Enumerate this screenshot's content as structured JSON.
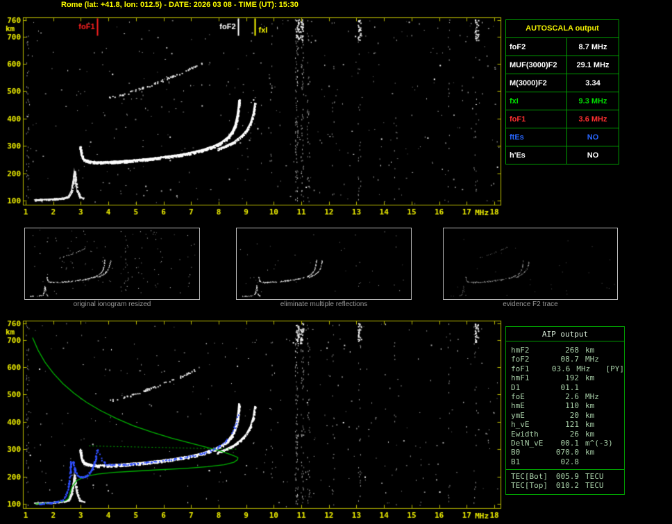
{
  "title": "Rome (lat: +41.8, lon: 012.5) - DATE: 2026 03 08 - TIME (UT): 15:30",
  "colors": {
    "background": "#000000",
    "title_yellow": "#ffff00",
    "axis_yellow": "#f0f000",
    "plot_border": "#b8b800",
    "table_border_green": "#00a000",
    "trace_white": "#ffffff",
    "profile_green": "#00b400",
    "restored_trace_blue": "#3050ff",
    "caption_gray": "#989898",
    "aip_text_green": "#a8cfa8"
  },
  "autoscala_table": {
    "header": "AUTOSCALA output",
    "rows": [
      {
        "label": "foF2",
        "value": "8.7 MHz",
        "color": "#ffffff"
      },
      {
        "label": "MUF(3000)F2",
        "value": "29.1 MHz",
        "color": "#ffffff"
      },
      {
        "label": "M(3000)F2",
        "value": "3.34",
        "color": "#ffffff"
      },
      {
        "label": "fxI",
        "value": "9.3 MHz",
        "color": "#00dd00"
      },
      {
        "label": "foF1",
        "value": "3.6 MHz",
        "color": "#ff3030"
      },
      {
        "label": "ftEs",
        "value": "NO",
        "color": "#2866ff"
      },
      {
        "label": "h'Es",
        "value": "NO",
        "color": "#ffffff"
      }
    ]
  },
  "thumbnails": [
    {
      "caption": "original ionogram resized"
    },
    {
      "caption": "eliminate multiple reflections"
    },
    {
      "caption": "evidence F2 trace"
    }
  ],
  "aip_table": {
    "header": "AIP output",
    "rows": [
      {
        "name": "hmF2",
        "value": "268",
        "unit": "km",
        "extra": ""
      },
      {
        "name": "foF2",
        "value": "08.7",
        "unit": "MHz",
        "extra": ""
      },
      {
        "name": "foF1",
        "value": "03.6",
        "unit": "MHz",
        "extra": "[PY]"
      },
      {
        "name": "hmF1",
        "value": "192",
        "unit": "km",
        "extra": ""
      },
      {
        "name": "D1",
        "value": "01.1",
        "unit": "",
        "extra": ""
      },
      {
        "name": "foE",
        "value": "2.6",
        "unit": "MHz",
        "extra": ""
      },
      {
        "name": "hmE",
        "value": "110",
        "unit": "km",
        "extra": ""
      },
      {
        "name": "ymE",
        "value": "20",
        "unit": "km",
        "extra": ""
      },
      {
        "name": "h_vE",
        "value": "121",
        "unit": "km",
        "extra": ""
      },
      {
        "name": "Ewidth",
        "value": "26",
        "unit": "km",
        "extra": ""
      },
      {
        "name": "DelN_vE",
        "value": "00.1",
        "unit": "m^(-3)",
        "extra": ""
      },
      {
        "name": "B0",
        "value": "070.0",
        "unit": "km",
        "extra": ""
      },
      {
        "name": "B1",
        "value": "02.8",
        "unit": "",
        "extra": ""
      }
    ],
    "tec_rows": [
      {
        "name": "TEC[Bot]",
        "value": "005.9",
        "unit": "TECU",
        "extra": ""
      },
      {
        "name": "TEC[Top]",
        "value": "010.2",
        "unit": "TECU",
        "extra": ""
      }
    ]
  },
  "chart_data": {
    "type": "scatter",
    "axes": {
      "xlabel": "MHz",
      "ylabel": "km",
      "xlim": [
        1,
        18
      ],
      "ylim": [
        100,
        760
      ],
      "x_ticks": [
        1,
        2,
        3,
        4,
        5,
        6,
        7,
        8,
        9,
        10,
        11,
        12,
        13,
        14,
        15,
        16,
        17,
        18
      ],
      "y_ticks": [
        760,
        700,
        600,
        500,
        400,
        300,
        200,
        100
      ],
      "grid": false
    },
    "ionogram_traces": {
      "es_trace": [
        [
          1.3,
          103
        ],
        [
          1.7,
          105
        ],
        [
          2.1,
          107
        ],
        [
          2.4,
          110
        ],
        [
          2.55,
          116
        ],
        [
          2.65,
          136
        ],
        [
          2.72,
          175
        ],
        [
          2.76,
          208
        ],
        [
          2.8,
          172
        ],
        [
          2.86,
          138
        ],
        [
          2.95,
          114
        ],
        [
          3.1,
          108
        ]
      ],
      "f_trace": [
        [
          2.97,
          298
        ],
        [
          3.02,
          268
        ],
        [
          3.08,
          252
        ],
        [
          3.3,
          243
        ],
        [
          3.6,
          240
        ],
        [
          4.0,
          241
        ],
        [
          4.5,
          244
        ],
        [
          5.0,
          248
        ],
        [
          5.5,
          253
        ],
        [
          6.0,
          259
        ],
        [
          6.5,
          266
        ],
        [
          7.0,
          275
        ],
        [
          7.4,
          285
        ],
        [
          7.8,
          298
        ],
        [
          8.1,
          313
        ],
        [
          8.35,
          333
        ],
        [
          8.5,
          353
        ],
        [
          8.6,
          377
        ],
        [
          8.67,
          407
        ],
        [
          8.72,
          442
        ],
        [
          8.74,
          468
        ]
      ],
      "fx_trace": [
        [
          7.95,
          288
        ],
        [
          8.25,
          300
        ],
        [
          8.55,
          315
        ],
        [
          8.8,
          334
        ],
        [
          9.0,
          356
        ],
        [
          9.15,
          384
        ],
        [
          9.25,
          418
        ],
        [
          9.31,
          458
        ]
      ],
      "second_hop": [
        [
          4.05,
          478
        ],
        [
          4.6,
          492
        ],
        [
          5.2,
          512
        ],
        [
          5.8,
          534
        ],
        [
          6.4,
          558
        ],
        [
          6.9,
          580
        ],
        [
          7.35,
          602
        ]
      ]
    },
    "rfi_columns": [
      {
        "f": 1.06,
        "n": 45,
        "bright": 0.35
      },
      {
        "f": 9.9,
        "n": 12,
        "bright": 0.5
      },
      {
        "f": 10.82,
        "n": 85,
        "bright": 0.8
      },
      {
        "f": 11.03,
        "n": 60,
        "bright": 0.7
      },
      {
        "f": 11.25,
        "n": 38,
        "bright": 0.6
      },
      {
        "f": 12.15,
        "n": 14,
        "bright": 0.45
      },
      {
        "f": 13.1,
        "n": 26,
        "bright": 0.5
      },
      {
        "f": 14.4,
        "n": 10,
        "bright": 0.4
      },
      {
        "f": 16.35,
        "n": 16,
        "bright": 0.45
      },
      {
        "f": 17.3,
        "n": 22,
        "bright": 0.5
      }
    ],
    "top_bursts": [
      {
        "f": 10.85
      },
      {
        "f": 11.0
      },
      {
        "f": 13.1
      },
      {
        "f": 17.35
      }
    ],
    "top_plot": {
      "noise_count": 380,
      "markers": [
        {
          "name": "foF1",
          "freq": 3.6,
          "color": "#ff2020",
          "label_side": "left"
        },
        {
          "name": "foF2",
          "freq": 8.7,
          "color": "#ffffff",
          "label_side": "left"
        },
        {
          "name": "fxI",
          "freq": 9.3,
          "color": "#ffff00",
          "label_side": "right"
        }
      ]
    },
    "bottom_plot": {
      "noise_count": 300,
      "profile": [
        [
          1.25,
          708
        ],
        [
          1.45,
          662
        ],
        [
          1.7,
          618
        ],
        [
          2.0,
          578
        ],
        [
          2.35,
          540
        ],
        [
          2.75,
          505
        ],
        [
          3.2,
          472
        ],
        [
          3.7,
          442
        ],
        [
          4.3,
          412
        ],
        [
          4.9,
          386
        ],
        [
          5.6,
          362
        ],
        [
          6.3,
          340
        ],
        [
          7.0,
          322
        ],
        [
          7.6,
          306
        ],
        [
          8.1,
          292
        ],
        [
          8.45,
          280
        ],
        [
          8.65,
          272
        ],
        [
          8.7,
          268
        ],
        [
          8.68,
          261
        ],
        [
          8.55,
          252
        ],
        [
          8.2,
          243
        ],
        [
          7.6,
          236
        ],
        [
          6.8,
          230
        ],
        [
          5.9,
          225
        ],
        [
          5.0,
          220
        ],
        [
          4.2,
          215
        ],
        [
          3.6,
          209
        ],
        [
          3.15,
          200
        ],
        [
          2.85,
          185
        ],
        [
          2.68,
          162
        ],
        [
          2.6,
          138
        ],
        [
          2.55,
          120
        ],
        [
          2.45,
          112
        ],
        [
          2.2,
          108
        ],
        [
          1.9,
          104
        ],
        [
          1.6,
          101
        ],
        [
          1.35,
          100
        ]
      ],
      "profile_anchor_dotted": [
        [
          3.3,
          312
        ],
        [
          8.68,
          300
        ]
      ],
      "restored_trace_blue": [
        [
          [
            1.45,
            101
          ],
          [
            1.8,
            104
          ],
          [
            2.1,
            108
          ],
          [
            2.3,
            115
          ],
          [
            2.42,
            128
          ],
          [
            2.5,
            150
          ],
          [
            2.56,
            180
          ],
          [
            2.6,
            215
          ],
          [
            2.63,
            255
          ]
        ],
        [
          [
            2.7,
            258
          ],
          [
            2.78,
            220
          ],
          [
            2.9,
            203
          ],
          [
            3.05,
            198
          ],
          [
            3.2,
            204
          ],
          [
            3.35,
            220
          ],
          [
            3.47,
            248
          ],
          [
            3.55,
            280
          ],
          [
            3.59,
            300
          ]
        ],
        [
          [
            3.66,
            295
          ],
          [
            3.75,
            262
          ],
          [
            3.9,
            246
          ],
          [
            4.2,
            243
          ],
          [
            4.7,
            246
          ],
          [
            5.2,
            251
          ],
          [
            5.8,
            258
          ],
          [
            6.4,
            266
          ],
          [
            7.0,
            276
          ],
          [
            7.5,
            289
          ],
          [
            7.9,
            305
          ],
          [
            8.2,
            325
          ],
          [
            8.45,
            355
          ],
          [
            8.6,
            392
          ],
          [
            8.68,
            428
          ]
        ]
      ]
    }
  }
}
